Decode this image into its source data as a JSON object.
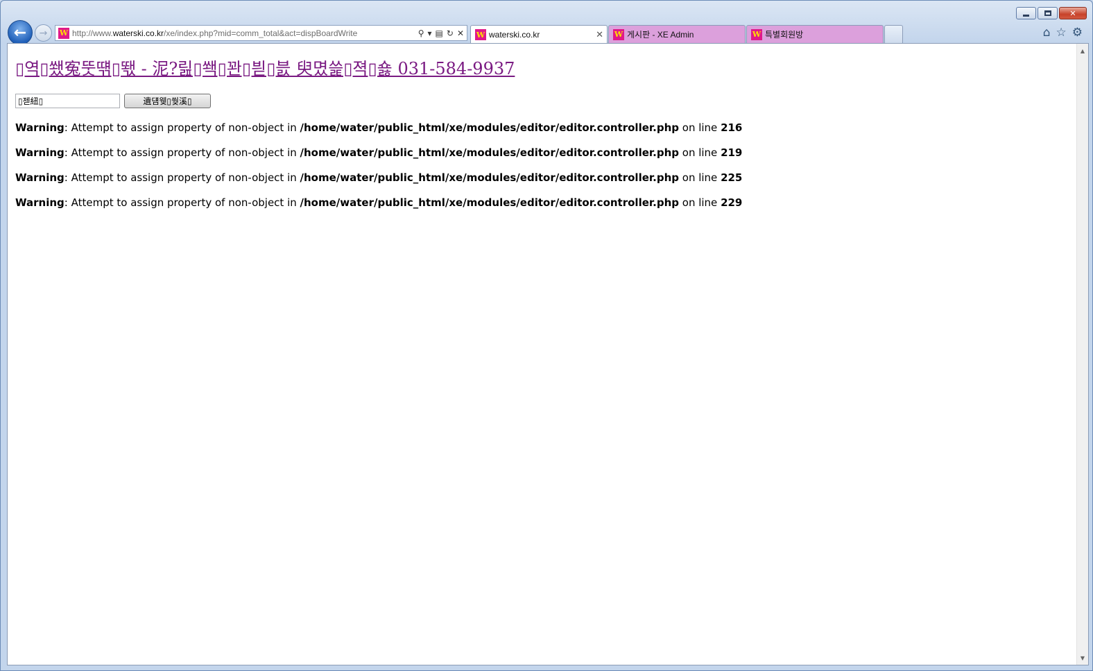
{
  "browser": {
    "address_url_prefix": "http://www.",
    "address_url_host": "waterski.co.kr",
    "address_url_path": "/xe/index.php?mid=comm_total&act=dispBoardWrite",
    "favicon_letter": "W",
    "tabs": [
      {
        "label": "waterski.co.kr",
        "close": "✕"
      },
      {
        "label": "게시판 - XE Admin"
      },
      {
        "label": "특별회원방"
      }
    ],
    "colors": {
      "tab_pink": "#dca0dc",
      "favicon_bg": "#e0198a",
      "link_visited": "#7a1a82"
    }
  },
  "page": {
    "title": "▯역▯쐤寃뚯떆▯뙋 - 泥?릺▯쐑▯꽌▯븯▯븘 臾몄쓽▯젹▯숋 031-584-9937",
    "input_value": "▯젣紐▯",
    "submit_label": "遺덈웾▯쒖溪▯",
    "warnings": [
      {
        "label": "Warning",
        "message": ": Attempt to assign property of non-object in ",
        "path": "/home/water/public_html/xe/modules/editor/editor.controller.php",
        "online": " on line ",
        "line": "216"
      },
      {
        "label": "Warning",
        "message": ": Attempt to assign property of non-object in ",
        "path": "/home/water/public_html/xe/modules/editor/editor.controller.php",
        "online": " on line ",
        "line": "219"
      },
      {
        "label": "Warning",
        "message": ": Attempt to assign property of non-object in ",
        "path": "/home/water/public_html/xe/modules/editor/editor.controller.php",
        "online": " on line ",
        "line": "225"
      },
      {
        "label": "Warning",
        "message": ": Attempt to assign property of non-object in ",
        "path": "/home/water/public_html/xe/modules/editor/editor.controller.php",
        "online": " on line ",
        "line": "229"
      }
    ]
  },
  "icons": {
    "back": "back-arrow-icon",
    "forward": "forward-arrow-icon",
    "search": "search-icon",
    "home": "home-icon",
    "favorites": "star-icon",
    "tools": "gear-icon"
  }
}
